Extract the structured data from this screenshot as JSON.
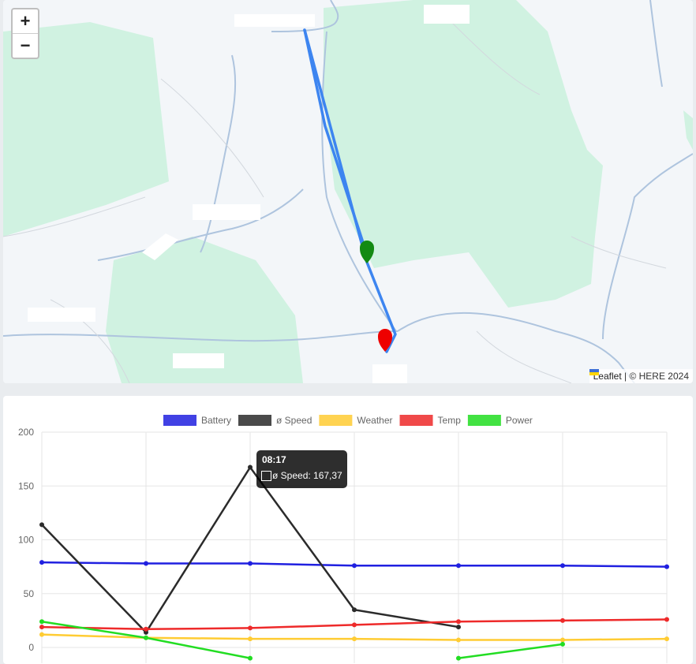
{
  "map": {
    "zoom_in_label": "+",
    "zoom_out_label": "−",
    "attribution_link": "Leaflet",
    "attribution_text": " | © HERE 2024",
    "route_color": "#3d85f0",
    "start_marker_color": "#138a13",
    "end_marker_color": "#ee0000"
  },
  "chart": {
    "tooltip_title": "08:17",
    "tooltip_body": "ø Speed: 167,37",
    "legend": [
      {
        "name": "Battery",
        "color": "#2020e0"
      },
      {
        "name": "ø Speed",
        "color": "#2b2b2b"
      },
      {
        "name": "Weather",
        "color": "#ffcc33"
      },
      {
        "name": "Temp",
        "color": "#ee2a2a"
      },
      {
        "name": "Power",
        "color": "#22dd22"
      }
    ]
  },
  "chart_data": {
    "type": "line",
    "x": [
      0,
      1,
      2,
      3,
      4,
      5,
      6
    ],
    "ylim": [
      0,
      200
    ],
    "yticks": [
      0,
      50,
      100,
      150,
      200
    ],
    "grid": true,
    "legend_position": "top",
    "series": [
      {
        "name": "Battery",
        "color": "#2020e0",
        "values": [
          79,
          78,
          78,
          76,
          76,
          76,
          75
        ]
      },
      {
        "name": "ø Speed",
        "color": "#2b2b2b",
        "values": [
          114,
          14,
          167.37,
          35,
          19,
          null,
          null
        ]
      },
      {
        "name": "Weather",
        "color": "#ffcc33",
        "values": [
          12,
          9,
          8,
          8,
          7,
          7,
          8
        ]
      },
      {
        "name": "Temp",
        "color": "#ee2a2a",
        "values": [
          19,
          17,
          18,
          21,
          24,
          25,
          26
        ]
      },
      {
        "name": "Power",
        "color": "#22dd22",
        "values": [
          24,
          9,
          -10,
          null,
          -10,
          3,
          null
        ]
      }
    ]
  }
}
